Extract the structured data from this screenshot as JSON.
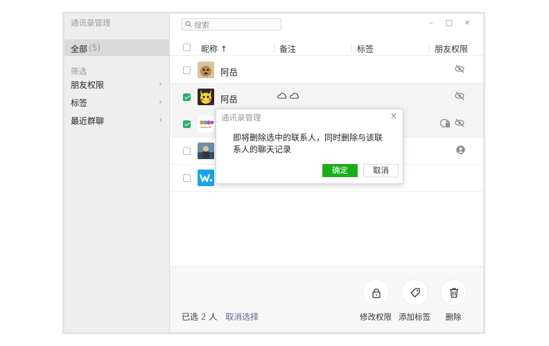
{
  "window": {
    "title": "通讯录管理",
    "controls": [
      "–",
      "□",
      "×"
    ]
  },
  "sidebar": {
    "all": {
      "label": "全部",
      "count": "(5)"
    },
    "filter_title": "筛选",
    "items": [
      {
        "label": "朋友权限",
        "chevron": "›"
      },
      {
        "label": "标签",
        "chevron": "›"
      },
      {
        "label": "最近群聊",
        "chevron": "›"
      }
    ]
  },
  "search": {
    "placeholder": "搜索"
  },
  "columns": {
    "nickname": "昵称 ↑",
    "remark": "备注",
    "tags": "标签",
    "permission": "朋友权限"
  },
  "contacts": [
    {
      "name": "阿岳",
      "checked": false,
      "remark_icons": [],
      "permission_icons": [
        "eye-slash-icon"
      ]
    },
    {
      "name": "阿岳",
      "checked": true,
      "remark_icons": [
        "cloud-icon",
        "cloud-icon"
      ],
      "permission_icons": [
        "eye-slash-icon"
      ]
    },
    {
      "name": "",
      "checked": true,
      "remark_icons": [],
      "permission_icons": [
        "lock-icon",
        "eye-slash-icon"
      ]
    },
    {
      "name": "",
      "checked": false,
      "remark_icons": [],
      "permission_icons": [
        "person-icon"
      ]
    },
    {
      "name": "",
      "checked": false,
      "remark_icons": [],
      "permission_icons": []
    }
  ],
  "footer": {
    "selected_prefix": "已选",
    "selected_count": "2",
    "selected_unit": "人",
    "cancel_selection": "取消选择",
    "actions": [
      {
        "label": "修改权限",
        "icon": "lock-icon"
      },
      {
        "label": "添加标签",
        "icon": "tag-icon"
      },
      {
        "label": "删除",
        "icon": "trash-icon"
      }
    ]
  },
  "dialog": {
    "title": "通讯录管理",
    "close": "×",
    "message": "即将删除选中的联系人，同时删除与该联系人的聊天记录",
    "confirm": "确定",
    "cancel": "取消"
  },
  "colors": {
    "accent_green": "#1aad19",
    "check_green": "#2aae67",
    "link_blue": "#576b95"
  }
}
